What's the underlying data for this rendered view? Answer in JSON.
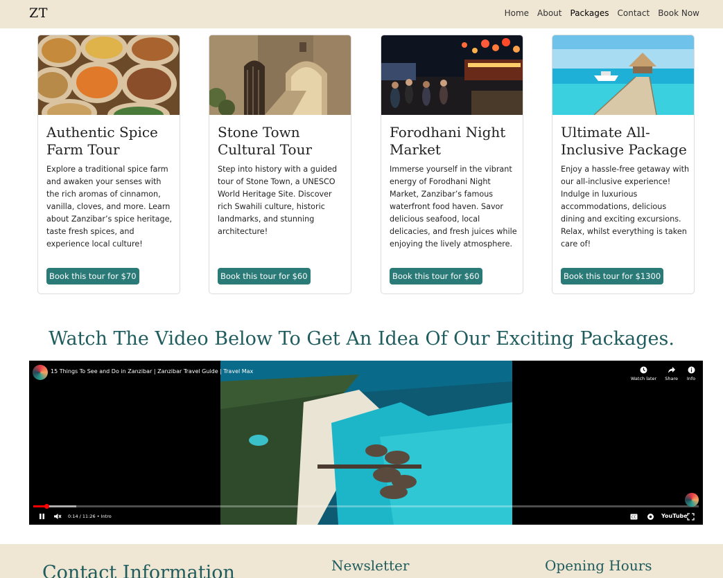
{
  "navbar": {
    "brand": "ZT",
    "links": [
      {
        "label": "Home"
      },
      {
        "label": "About"
      },
      {
        "label": "Packages"
      },
      {
        "label": "Contact"
      },
      {
        "label": "Book Now"
      }
    ]
  },
  "cards": [
    {
      "title": "Authentic Spice Farm Tour",
      "text": "Explore a traditional spice farm and awaken your senses with the rich aromas of cinnamon, vanilla, cloves, and more. Learn about Zanzibar’s spice heritage, taste fresh spices, and experience local culture!",
      "button": "Book this tour for $70",
      "image_icon": "spices-image"
    },
    {
      "title": "Stone Town Cultural Tour",
      "text": "Step into history with a guided tour of Stone Town, a UNESCO World Heritage Site. Discover rich Swahili culture, historic landmarks, and stunning architecture!",
      "button": "Book this tour for $60",
      "image_icon": "stone-archway-image"
    },
    {
      "title": "Forodhani Night Market",
      "text": "Immerse yourself in the vibrant energy of Forodhani Night Market, Zanzibar’s famous waterfront food haven. Savor delicious seafood, local delicacies, and fresh juices while enjoying the lively atmosphere.",
      "button": "Book this tour for $60",
      "image_icon": "night-market-image"
    },
    {
      "title": "Ultimate All-Inclusive Package",
      "text": "Enjoy a hassle-free getaway with our all-inclusive experience! Indulge in luxurious accommodations, delicious dining and exciting excursions. Relax, whilst everything is taken care of!",
      "button": "Book this tour for $1300",
      "image_icon": "beach-pier-image"
    }
  ],
  "video_heading": "Watch The Video Below To Get An Idea Of Our Exciting Packages.",
  "video": {
    "title": "15 Things To See and Do in Zanzibar | Zanzibar Travel Guide | Travel Max",
    "actions": [
      {
        "label": "Watch later",
        "icon": "clock-icon"
      },
      {
        "label": "Share",
        "icon": "share-icon"
      },
      {
        "label": "Info",
        "icon": "info-icon"
      }
    ],
    "time": "0:14 / 11:26 • Intro",
    "brand": "YouTube",
    "progress_fraction": 0.02,
    "buffered_fraction": 0.065
  },
  "footer": {
    "contact_title": "Contact Information",
    "newsletter_title": "Newsletter",
    "hours_title": "Opening Hours"
  },
  "colors": {
    "nav_bg": "#efe6d4",
    "accent": "#2a7a78",
    "heading": "#1f5c5d"
  }
}
